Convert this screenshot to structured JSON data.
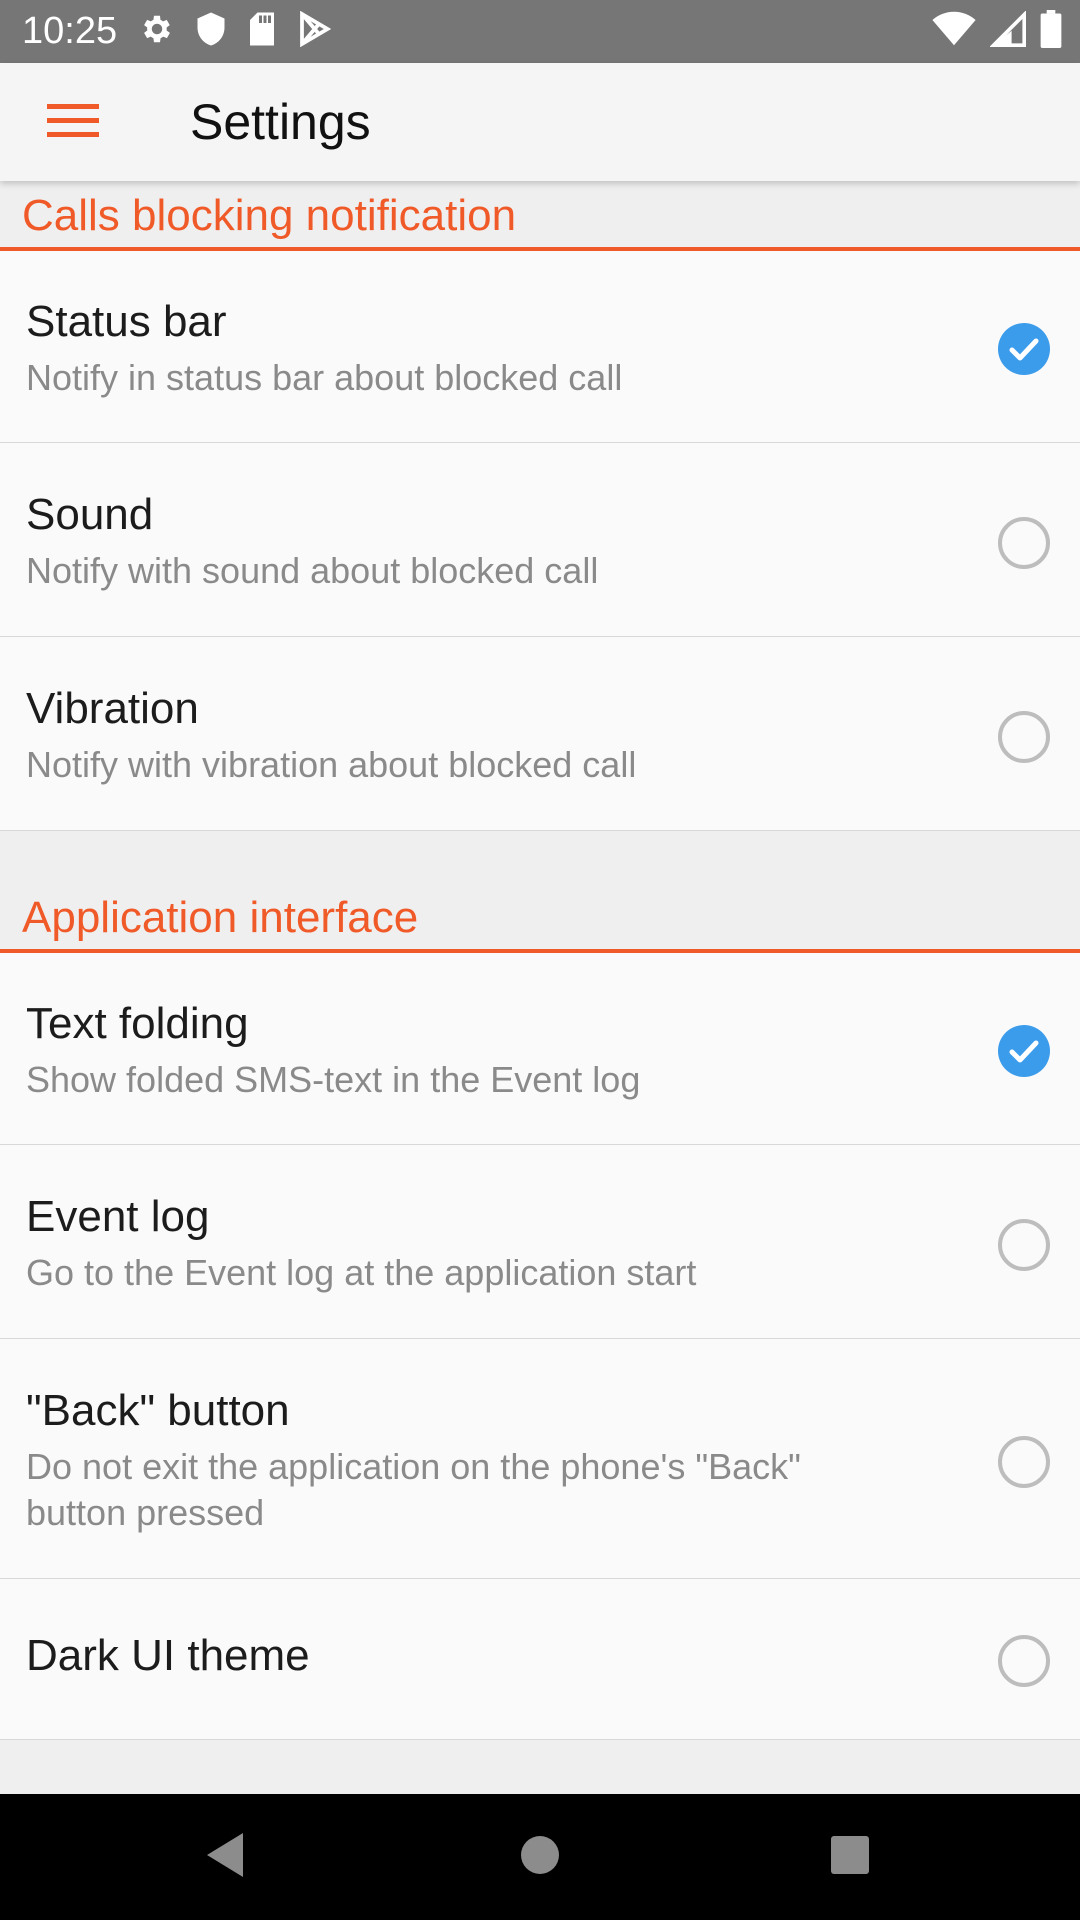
{
  "status_bar": {
    "time": "10:25",
    "left_icons": [
      "gear-icon",
      "shield-icon",
      "sd-card-icon",
      "play-store-icon"
    ],
    "right_icons": [
      "wifi-icon",
      "cell-signal-icon",
      "battery-icon"
    ]
  },
  "app_bar": {
    "title": "Settings",
    "menu_icon": "hamburger-menu-icon",
    "accent_color": "#f05a28"
  },
  "sections": [
    {
      "header": "Calls blocking notification",
      "items": [
        {
          "title": "Status bar",
          "subtitle": "Notify in status bar about blocked call",
          "checked": true
        },
        {
          "title": "Sound",
          "subtitle": "Notify with sound about blocked call",
          "checked": false
        },
        {
          "title": "Vibration",
          "subtitle": "Notify with vibration about blocked call",
          "checked": false
        }
      ]
    },
    {
      "header": "Application interface",
      "items": [
        {
          "title": "Text folding",
          "subtitle": "Show folded SMS-text in the Event log",
          "checked": true
        },
        {
          "title": "Event log",
          "subtitle": "Go to the Event log at the application start",
          "checked": false
        },
        {
          "title": "\"Back\" button",
          "subtitle": "Do not exit the application on the phone's \"Back\" button pressed",
          "checked": false
        },
        {
          "title": "Dark UI theme",
          "subtitle": "",
          "checked": false
        }
      ]
    }
  ],
  "colors": {
    "checked": "#3b9cec",
    "unchecked_border": "#bdbdbd",
    "section_header": "#f05a28"
  },
  "nav_bar": {
    "buttons": [
      "back-icon",
      "home-icon",
      "recents-icon"
    ]
  }
}
